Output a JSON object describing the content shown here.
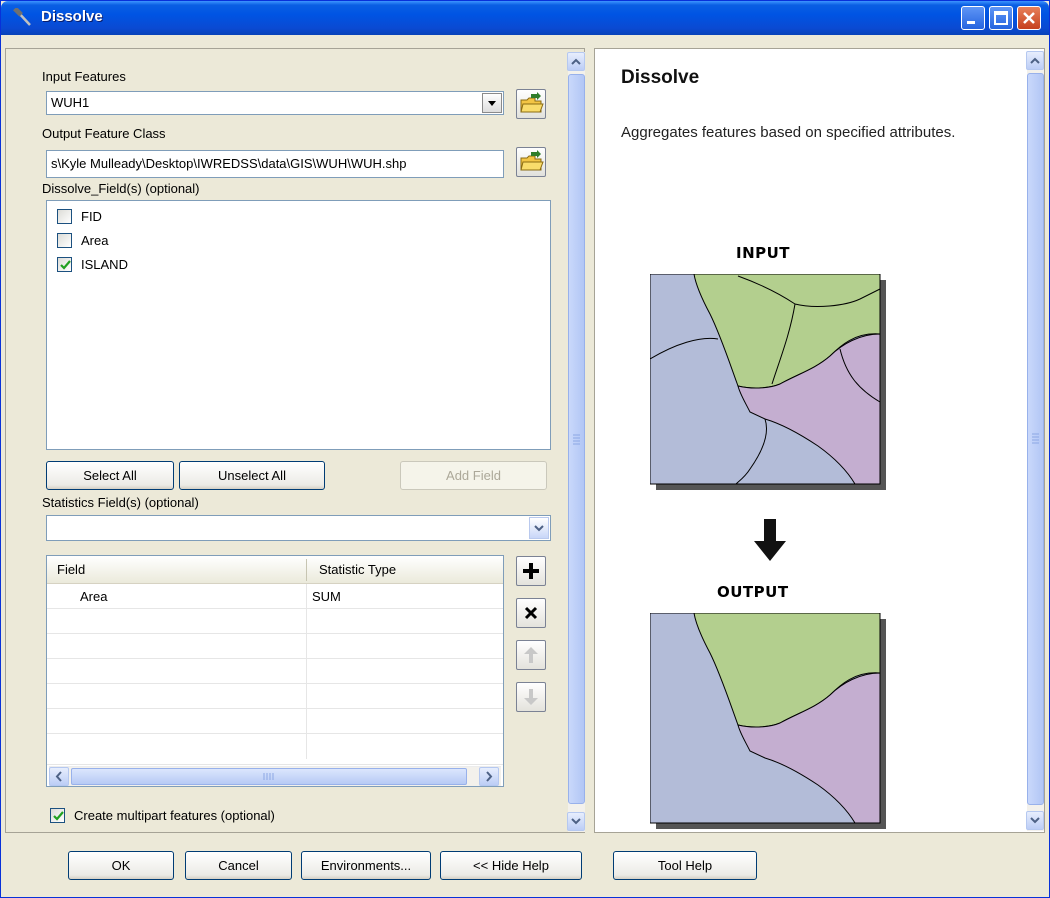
{
  "window": {
    "title": "Dissolve"
  },
  "form": {
    "input_features_label": "Input Features",
    "input_features_value": "WUH1",
    "output_class_label": "Output Feature Class",
    "output_class_value": "s\\Kyle Mulleady\\Desktop\\IWREDSS\\data\\GIS\\WUH\\WUH.shp",
    "dissolve_fields_label": "Dissolve_Field(s) (optional)",
    "dissolve_fields": [
      {
        "name": "FID",
        "checked": false
      },
      {
        "name": "Area",
        "checked": false
      },
      {
        "name": "ISLAND",
        "checked": true
      }
    ],
    "select_all_label": "Select All",
    "unselect_all_label": "Unselect All",
    "add_field_label": "Add Field",
    "statistics_label": "Statistics Field(s) (optional)",
    "statistics_value": "",
    "grid": {
      "headers": [
        "Field",
        "Statistic Type"
      ],
      "rows": [
        {
          "field": "Area",
          "stat": "SUM"
        }
      ]
    },
    "multipart_label": "Create multipart features (optional)",
    "multipart_checked": true
  },
  "help": {
    "title": "Dissolve",
    "description": "Aggregates features based on specified attributes.",
    "input_label": "INPUT",
    "output_label": "OUTPUT"
  },
  "footer": {
    "ok": "OK",
    "cancel": "Cancel",
    "environments": "Environments...",
    "hide_help": "<< Hide Help",
    "tool_help": "Tool Help"
  },
  "colors": {
    "map_blue": "#b3bcd8",
    "map_green": "#b3cf8e",
    "map_purple": "#c4aed0",
    "titlebar": "#0054e3"
  }
}
